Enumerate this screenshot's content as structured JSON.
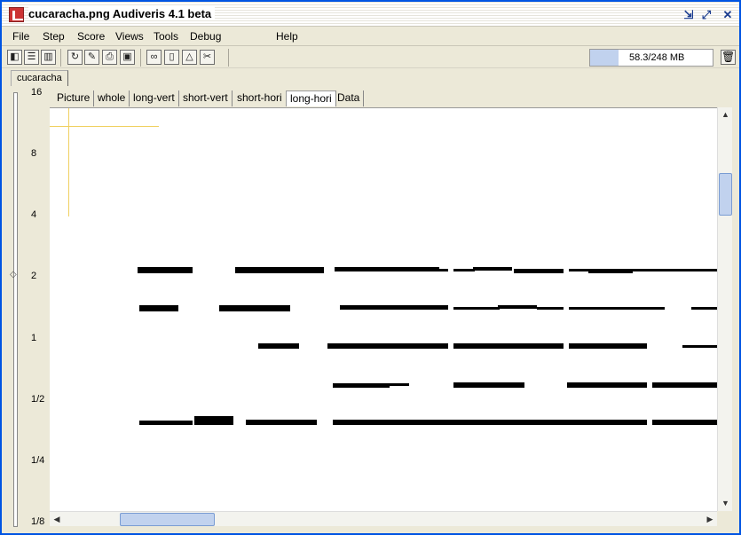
{
  "window": {
    "title": "cucaracha.png Audiveris 4.1 beta"
  },
  "menu": [
    "File",
    "Step",
    "Score",
    "Views",
    "Tools",
    "Debug",
    "Help"
  ],
  "memory": {
    "text": "58.3/248 MB",
    "used_fraction": 0.235
  },
  "document_tab": "cucaracha",
  "scale": {
    "labels": [
      "16",
      "8",
      "4",
      "2",
      "1",
      "1/2",
      "1/4",
      "1/8"
    ]
  },
  "view_tabs": [
    "Picture",
    "whole",
    "long-vert",
    "short-vert",
    "short-hori",
    "long-hori",
    "Data"
  ],
  "active_view_tab": "long-hori",
  "icons": {
    "toolbar": [
      "open-icon",
      "split-icon",
      "columns-icon",
      "refresh-icon",
      "edit-icon",
      "print-icon",
      "save-icon",
      "binoculars-icon",
      "book-icon",
      "shape-icon",
      "cut-icon"
    ],
    "trash": "trash-icon"
  },
  "colors": {
    "title_accent": "#0054e3",
    "selection": "#c1d2ee",
    "guide_line": "#f0d060"
  }
}
